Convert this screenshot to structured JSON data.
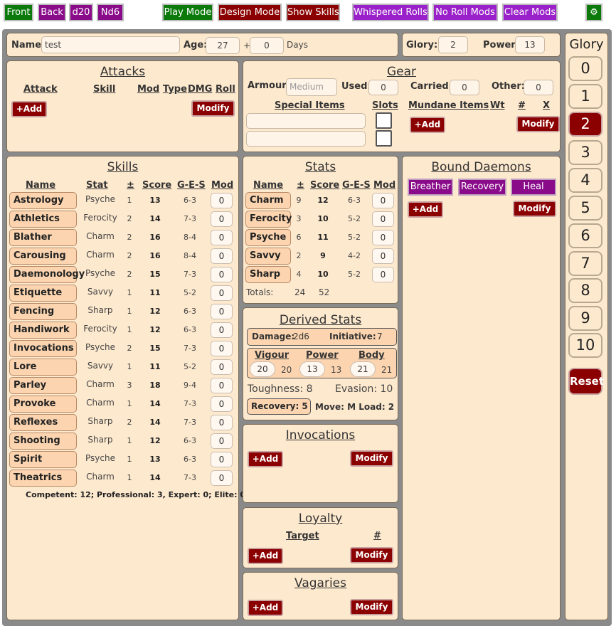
{
  "toolbar": {
    "front": "Front",
    "back": "Back",
    "d20": "d20",
    "nd6": "Nd6",
    "play_mode": "Play Mode",
    "design_mode": "Design Mode",
    "show_skills": "Show Skills",
    "whispered_rolls": "Whispered Rolls",
    "no_roll_mods": "No Roll Mods",
    "clear_mods": "Clear Mods",
    "settings_icon": "⚙"
  },
  "colors": {
    "green": "#0b7a0b",
    "purple": "#8a0b8a",
    "red": "#8b0000",
    "violet": "#9a21c9",
    "panel": "#fde9ce"
  },
  "identity": {
    "name_label": "Name:",
    "name_value": "test",
    "age_label": "Age:",
    "age_value": "27",
    "plus": "+",
    "days_value": "0",
    "days_label": "Days"
  },
  "glory_power": {
    "glory_label": "Glory:",
    "glory_value": "2",
    "power_label": "Power:",
    "power_value": "13"
  },
  "attacks": {
    "title": "Attacks",
    "headers": [
      "Attack",
      "Skill",
      "Mod",
      "Type",
      "DMG",
      "Roll"
    ],
    "add": "+Add",
    "modify": "Modify"
  },
  "gear": {
    "title": "Gear",
    "armour_label": "Armour:",
    "armour_placeholder": "Medium",
    "used_label": "Used:",
    "used_value": "0",
    "carried_label": "Carried:",
    "carried_value": "0",
    "other_label": "Other:",
    "other_value": "0",
    "special_items": "Special Items",
    "slots": "Slots",
    "mundane_items": "Mundane Items",
    "wt": "Wt",
    "hash": "#",
    "x": "X",
    "add": "+Add",
    "modify": "Modify"
  },
  "skills": {
    "title": "Skills",
    "headers": [
      "Name",
      "Stat",
      "±",
      "Score",
      "G-E-S",
      "Mod"
    ],
    "rows": [
      {
        "name": "Astrology",
        "stat": "Psyche",
        "pm": "1",
        "score": "13",
        "ges": "6-3",
        "mod": "0"
      },
      {
        "name": "Athletics",
        "stat": "Ferocity",
        "pm": "2",
        "score": "14",
        "ges": "7-3",
        "mod": "0"
      },
      {
        "name": "Blather",
        "stat": "Charm",
        "pm": "2",
        "score": "16",
        "ges": "8-4",
        "mod": "0"
      },
      {
        "name": "Carousing",
        "stat": "Charm",
        "pm": "2",
        "score": "16",
        "ges": "8-4",
        "mod": "0"
      },
      {
        "name": "Daemonology",
        "stat": "Psyche",
        "pm": "2",
        "score": "15",
        "ges": "7-3",
        "mod": "0"
      },
      {
        "name": "Etiquette",
        "stat": "Savvy",
        "pm": "1",
        "score": "11",
        "ges": "5-2",
        "mod": "0"
      },
      {
        "name": "Fencing",
        "stat": "Sharp",
        "pm": "1",
        "score": "12",
        "ges": "6-3",
        "mod": "0"
      },
      {
        "name": "Handiwork",
        "stat": "Ferocity",
        "pm": "1",
        "score": "12",
        "ges": "6-3",
        "mod": "0"
      },
      {
        "name": "Invocations",
        "stat": "Psyche",
        "pm": "2",
        "score": "15",
        "ges": "7-3",
        "mod": "0"
      },
      {
        "name": "Lore",
        "stat": "Savvy",
        "pm": "1",
        "score": "11",
        "ges": "5-2",
        "mod": "0"
      },
      {
        "name": "Parley",
        "stat": "Charm",
        "pm": "3",
        "score": "18",
        "ges": "9-4",
        "mod": "0"
      },
      {
        "name": "Provoke",
        "stat": "Charm",
        "pm": "1",
        "score": "14",
        "ges": "7-3",
        "mod": "0"
      },
      {
        "name": "Reflexes",
        "stat": "Sharp",
        "pm": "2",
        "score": "14",
        "ges": "7-3",
        "mod": "0"
      },
      {
        "name": "Shooting",
        "stat": "Sharp",
        "pm": "1",
        "score": "12",
        "ges": "6-3",
        "mod": "0"
      },
      {
        "name": "Spirit",
        "stat": "Psyche",
        "pm": "1",
        "score": "13",
        "ges": "6-3",
        "mod": "0"
      },
      {
        "name": "Theatrics",
        "stat": "Charm",
        "pm": "1",
        "score": "14",
        "ges": "7-3",
        "mod": "0"
      }
    ],
    "summary": "Competent: 12; Professional: 3, Expert: 0; Elite: 0"
  },
  "stats": {
    "title": "Stats",
    "headers": [
      "Name",
      "±",
      "Score",
      "G-E-S",
      "Mod"
    ],
    "rows": [
      {
        "name": "Charm",
        "pm": "9",
        "score": "12",
        "ges": "6-3",
        "mod": "0"
      },
      {
        "name": "Ferocity",
        "pm": "3",
        "score": "10",
        "ges": "5-2",
        "mod": "0"
      },
      {
        "name": "Psyche",
        "pm": "6",
        "score": "11",
        "ges": "5-2",
        "mod": "0"
      },
      {
        "name": "Savvy",
        "pm": "2",
        "score": "9",
        "ges": "4-2",
        "mod": "0"
      },
      {
        "name": "Sharp",
        "pm": "4",
        "score": "10",
        "ges": "5-2",
        "mod": "0"
      }
    ],
    "totals_label": "Totals:",
    "totals_pm": "24",
    "totals_score": "52"
  },
  "derived": {
    "title": "Derived Stats",
    "damage_label": "Damage:",
    "damage_value": "2d6",
    "initiative_label": "Initiative:",
    "initiative_value": "7",
    "vigour_label": "Vigour",
    "vigour_value": "20",
    "vigour_max": "20",
    "power_label": "Power",
    "power_value": "13",
    "power_max": "13",
    "body_label": "Body",
    "body_value": "21",
    "body_max": "21",
    "toughness": "Toughness: 8",
    "evasion": "Evasion: 10",
    "recovery": "Recovery: 5",
    "move_load": "Move: M  Load: 2"
  },
  "invocations": {
    "title": "Invocations",
    "add": "+Add",
    "modify": "Modify"
  },
  "loyalty": {
    "title": "Loyalty",
    "target": "Target",
    "hash": "#",
    "add": "+Add",
    "modify": "Modify"
  },
  "vagaries": {
    "title": "Vagaries",
    "add": "+Add",
    "modify": "Modify"
  },
  "daemons": {
    "title": "Bound Daemons",
    "tags": [
      "Breather",
      "Recovery",
      "Heal"
    ],
    "add": "+Add",
    "modify": "Modify"
  },
  "glory_track": {
    "title": "Glory",
    "values": [
      "0",
      "1",
      "2",
      "3",
      "4",
      "5",
      "6",
      "7",
      "8",
      "9",
      "10"
    ],
    "selected": "2",
    "reset": "Reset"
  }
}
